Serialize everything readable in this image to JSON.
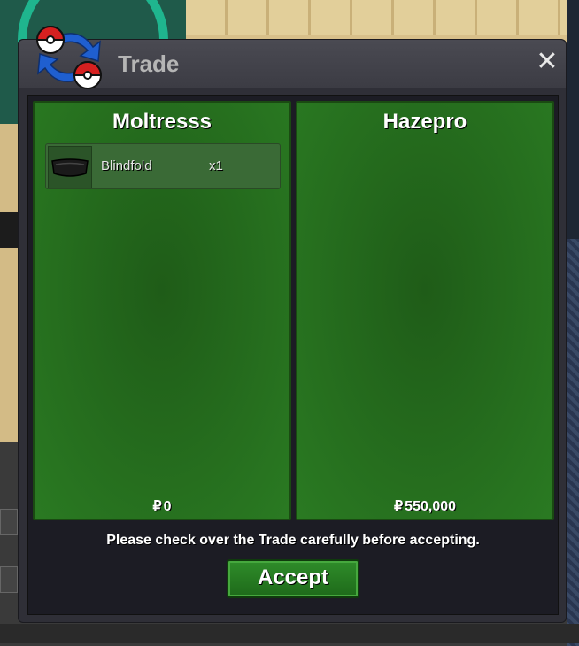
{
  "window": {
    "title": "Trade",
    "close_icon": "close-icon",
    "logo_icon": "pokeball-trade-icon"
  },
  "trade": {
    "left": {
      "player": "Moltresss",
      "items": [
        {
          "name": "Blindfold",
          "qty": "x1",
          "icon": "blindfold-icon"
        }
      ],
      "money": "0"
    },
    "right": {
      "player": "Hazepro",
      "items": [],
      "money": "550,000"
    },
    "currency_symbol": "₽"
  },
  "notice": "Please check over the Trade carefully before accepting.",
  "accept_label": "Accept",
  "colors": {
    "panel_green": "#2a7a22",
    "button_green": "#2f8c2a",
    "window_bg": "#2f2f37"
  }
}
